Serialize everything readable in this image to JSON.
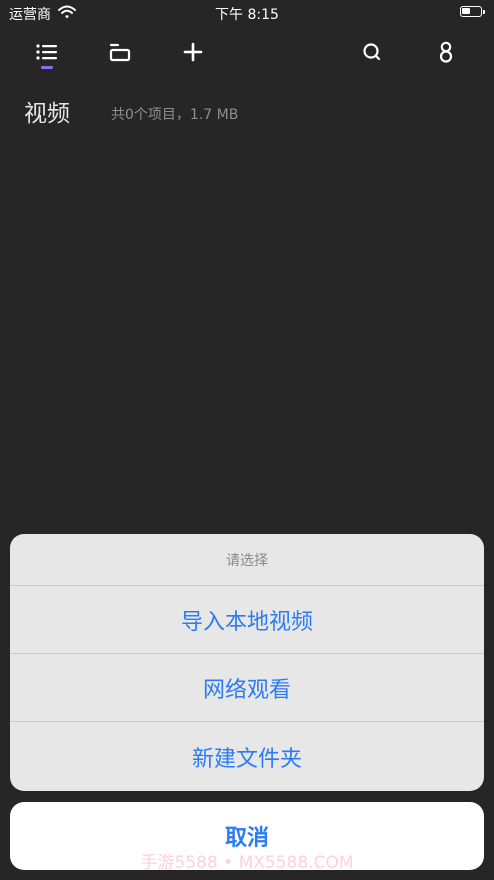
{
  "status_bar": {
    "carrier": "运营商",
    "time": "下午 8:15"
  },
  "toolbar": {
    "items": [
      {
        "icon": "list-icon",
        "active": true
      },
      {
        "icon": "folder-icon",
        "active": false
      },
      {
        "icon": "plus-icon",
        "active": false
      },
      {
        "icon": "search-icon",
        "active": false
      },
      {
        "icon": "user-icon",
        "active": false
      }
    ],
    "accent_color": "#8b6df5"
  },
  "header": {
    "title": "视频",
    "summary": "共0个项目，1.7 MB"
  },
  "action_sheet": {
    "title": "请选择",
    "options": [
      "导入本地视频",
      "网络观看",
      "新建文件夹"
    ],
    "cancel_label": "取消",
    "button_color": "#2b7cf4"
  },
  "watermark": "手游5588 • MX5588.COM"
}
